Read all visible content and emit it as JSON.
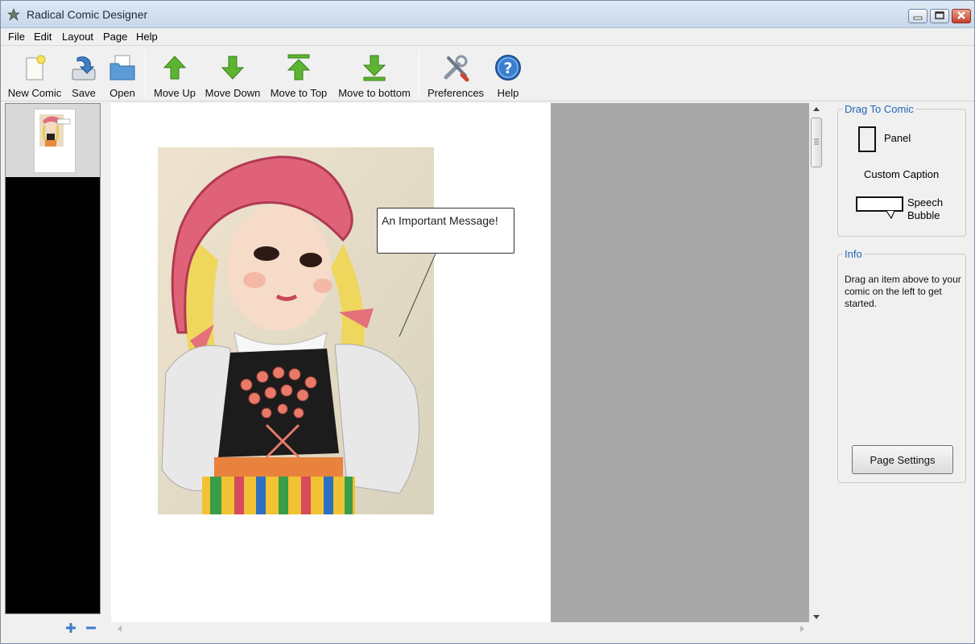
{
  "window": {
    "title": "Radical Comic Designer"
  },
  "menu": {
    "items": [
      "File",
      "Edit",
      "Layout",
      "Page",
      "Help"
    ]
  },
  "toolbar": {
    "items": [
      {
        "label": "New Comic",
        "icon": "new-comic-icon"
      },
      {
        "label": "Save",
        "icon": "save-icon"
      },
      {
        "label": "Open",
        "icon": "open-folder-icon"
      },
      {
        "label": "Move Up",
        "icon": "arrow-up-icon"
      },
      {
        "label": "Move Down",
        "icon": "arrow-down-icon"
      },
      {
        "label": "Move to Top",
        "icon": "arrow-top-icon"
      },
      {
        "label": "Move to bottom",
        "icon": "arrow-bottom-icon"
      },
      {
        "label": "Preferences",
        "icon": "tools-icon"
      },
      {
        "label": "Help",
        "icon": "help-icon"
      }
    ]
  },
  "canvas": {
    "speech_bubble_text": "An Important Message!"
  },
  "drag_panel": {
    "title": "Drag To Comic",
    "panel_label": "Panel",
    "caption_label": "Custom Caption",
    "bubble_label": "Speech Bubble"
  },
  "info_panel": {
    "title": "Info",
    "text": "Drag an item above to your comic on the left to get started.",
    "page_settings_label": "Page Settings"
  },
  "colors": {
    "accent_title": "#2266bb",
    "arrow_green": "#5cb531",
    "canvas_gray": "#a8a8a8",
    "page_list_bg": "#000000"
  }
}
